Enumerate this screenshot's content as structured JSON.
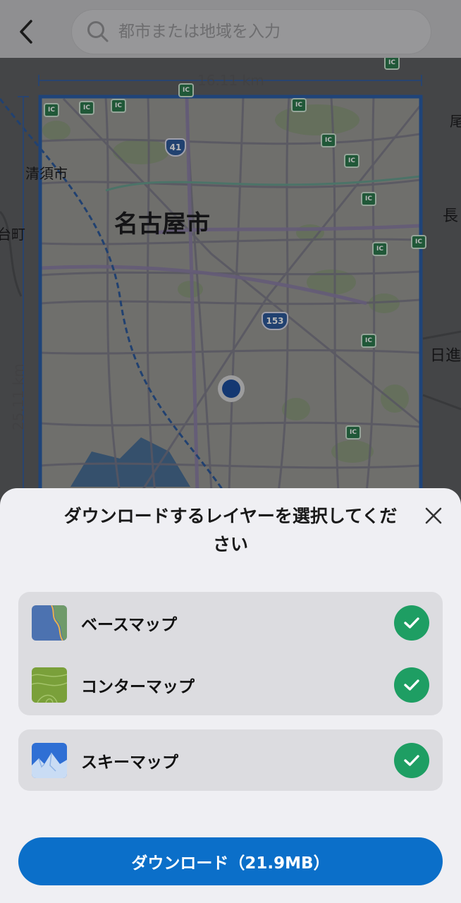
{
  "search": {
    "placeholder": "都市または地域を入力"
  },
  "map": {
    "width_label": "16.11 km",
    "height_label": "25.11 km",
    "places": {
      "main_city": "名古屋市",
      "kiyosu": "清須市",
      "partial_left": "台町",
      "partial_right_top": "尾",
      "partial_right_mid": "長",
      "partial_right_low": "日進"
    },
    "route_numbers": {
      "route_a": "41",
      "route_b": "153"
    },
    "ic_badge": "IC"
  },
  "sheet": {
    "title": "ダウンロードするレイヤーを選択してください",
    "layers": [
      {
        "label": "ベースマップ",
        "checked": true,
        "thumb": "basemap-thumb"
      },
      {
        "label": "コンターマップ",
        "checked": true,
        "thumb": "contour-thumb"
      },
      {
        "label": "スキーマップ",
        "checked": true,
        "thumb": "ski-thumb"
      }
    ],
    "download_label": "ダウンロード（21.9MB）"
  },
  "colors": {
    "accent": "#0b6fc9",
    "check_green": "#1e9e63",
    "selection_border": "#2c5fa8"
  }
}
